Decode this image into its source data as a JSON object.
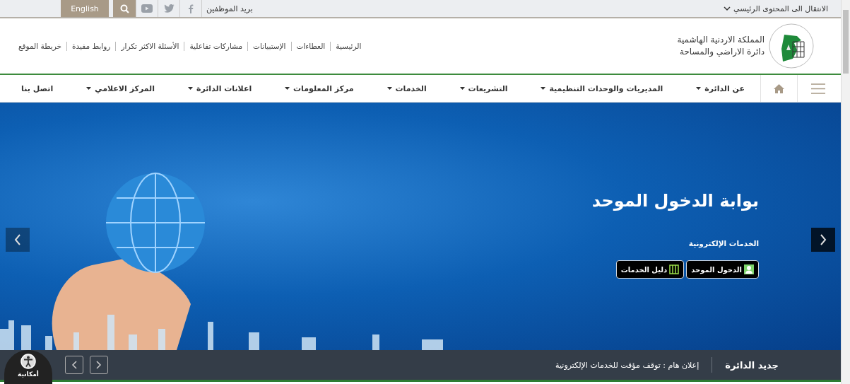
{
  "top_bar": {
    "skip_link": "الانتقال الى المحتوى الرئيسي",
    "staff_mail": "بريد الموظفين",
    "language": "English"
  },
  "header": {
    "logo_lines": [
      "المملكة الاردنية الهاشمية",
      "دائرة الاراضي والمساحة"
    ],
    "links": [
      "الرئيسية",
      "العطاءات",
      "الإستبيانات",
      "مشاركات تفاعلية",
      "الأسئلة الاكثر تكرار",
      "روابط مفيدة",
      "خريطة الموقع"
    ]
  },
  "nav": {
    "items": [
      {
        "label": "عن الدائرة",
        "dropdown": true
      },
      {
        "label": "المديريات والوحدات التنظيمية",
        "dropdown": true
      },
      {
        "label": "التشريعات",
        "dropdown": true
      },
      {
        "label": "الخدمات",
        "dropdown": true
      },
      {
        "label": "مركز المعلومات",
        "dropdown": true
      },
      {
        "label": "اعلانات الدائرة",
        "dropdown": true
      },
      {
        "label": "المركز الاعلامي",
        "dropdown": true
      },
      {
        "label": "اتصل بنا",
        "dropdown": false
      }
    ]
  },
  "slider": {
    "title": "بوابة الدخول الموحد",
    "subtitle": "الخدمات الإلكترونية",
    "buttons": [
      {
        "label": "الدخول الموحد",
        "kind": "user"
      },
      {
        "label": "دليل الخدمات",
        "kind": "book"
      }
    ]
  },
  "news": {
    "label": "جديد الدائرة",
    "text": "إعلان هام : توقف مؤقت للخدمات الإلكترونية"
  },
  "accessibility": {
    "label": "أمكانية"
  }
}
